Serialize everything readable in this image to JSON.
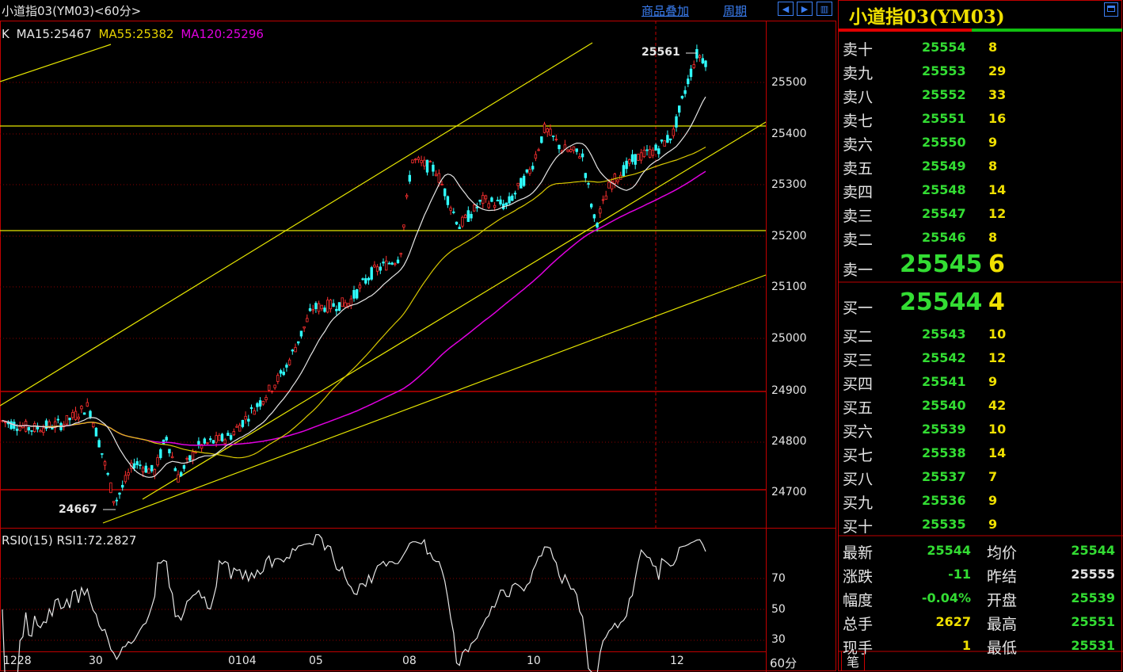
{
  "header": {
    "title": "小道指03(YM03)<60分>",
    "overlay_link": "商品叠加",
    "period_link": "周期",
    "buttons": [
      "prev-icon",
      "next-icon",
      "layout-icon"
    ]
  },
  "ma_legend": {
    "k": "K",
    "ma15": "MA15:25467",
    "ma55": "MA55:25382",
    "ma120": "MA120:25296",
    "colors": {
      "ma15": "#e6e6e6",
      "ma55": "#e6d200",
      "ma120": "#e000e0",
      "up": "#ff3030",
      "down": "#30ffff"
    }
  },
  "price_axis": [
    "25500",
    "25400",
    "25300",
    "25200",
    "25100",
    "25000",
    "24900",
    "24800",
    "24700"
  ],
  "rsi_axis": [
    "70",
    "50",
    "30"
  ],
  "date_axis": [
    "1228",
    "30",
    "0104",
    "05",
    "08",
    "10",
    "12"
  ],
  "annotations": {
    "high": "25561",
    "low": "24667"
  },
  "rsi_legend": {
    "name": "RSI0(15)",
    "value": "RSI1:72.2827"
  },
  "period_label": "60分",
  "panel": {
    "title": "小道指03(YM03)",
    "asks": [
      {
        "label": "卖十",
        "price": "25554",
        "vol": "8"
      },
      {
        "label": "卖九",
        "price": "25553",
        "vol": "29"
      },
      {
        "label": "卖八",
        "price": "25552",
        "vol": "33"
      },
      {
        "label": "卖七",
        "price": "25551",
        "vol": "16"
      },
      {
        "label": "卖六",
        "price": "25550",
        "vol": "9"
      },
      {
        "label": "卖五",
        "price": "25549",
        "vol": "8"
      },
      {
        "label": "卖四",
        "price": "25548",
        "vol": "14"
      },
      {
        "label": "卖三",
        "price": "25547",
        "vol": "12"
      },
      {
        "label": "卖二",
        "price": "25546",
        "vol": "8"
      },
      {
        "label": "卖一",
        "price": "25545",
        "vol": "6"
      }
    ],
    "bids": [
      {
        "label": "买一",
        "price": "25544",
        "vol": "4"
      },
      {
        "label": "买二",
        "price": "25543",
        "vol": "10"
      },
      {
        "label": "买三",
        "price": "25542",
        "vol": "12"
      },
      {
        "label": "买四",
        "price": "25541",
        "vol": "9"
      },
      {
        "label": "买五",
        "price": "25540",
        "vol": "42"
      },
      {
        "label": "买六",
        "price": "25539",
        "vol": "10"
      },
      {
        "label": "买七",
        "price": "25538",
        "vol": "14"
      },
      {
        "label": "买八",
        "price": "25537",
        "vol": "7"
      },
      {
        "label": "买九",
        "price": "25536",
        "vol": "9"
      },
      {
        "label": "买十",
        "price": "25535",
        "vol": "9"
      }
    ],
    "stats": {
      "latest_label": "最新",
      "latest": "25544",
      "avg_label": "均价",
      "avg": "25544",
      "change_label": "涨跌",
      "change": "-11",
      "prevclose_label": "昨结",
      "prevclose": "25555",
      "pct_label": "幅度",
      "pct": "-0.04%",
      "open_label": "开盘",
      "open": "25539",
      "volume_label": "总手",
      "volume": "2627",
      "high_label": "最高",
      "high": "25551",
      "cur_label": "现手",
      "cur": "1",
      "low_label": "最低",
      "low": "25531"
    },
    "tab": "笔"
  }
}
